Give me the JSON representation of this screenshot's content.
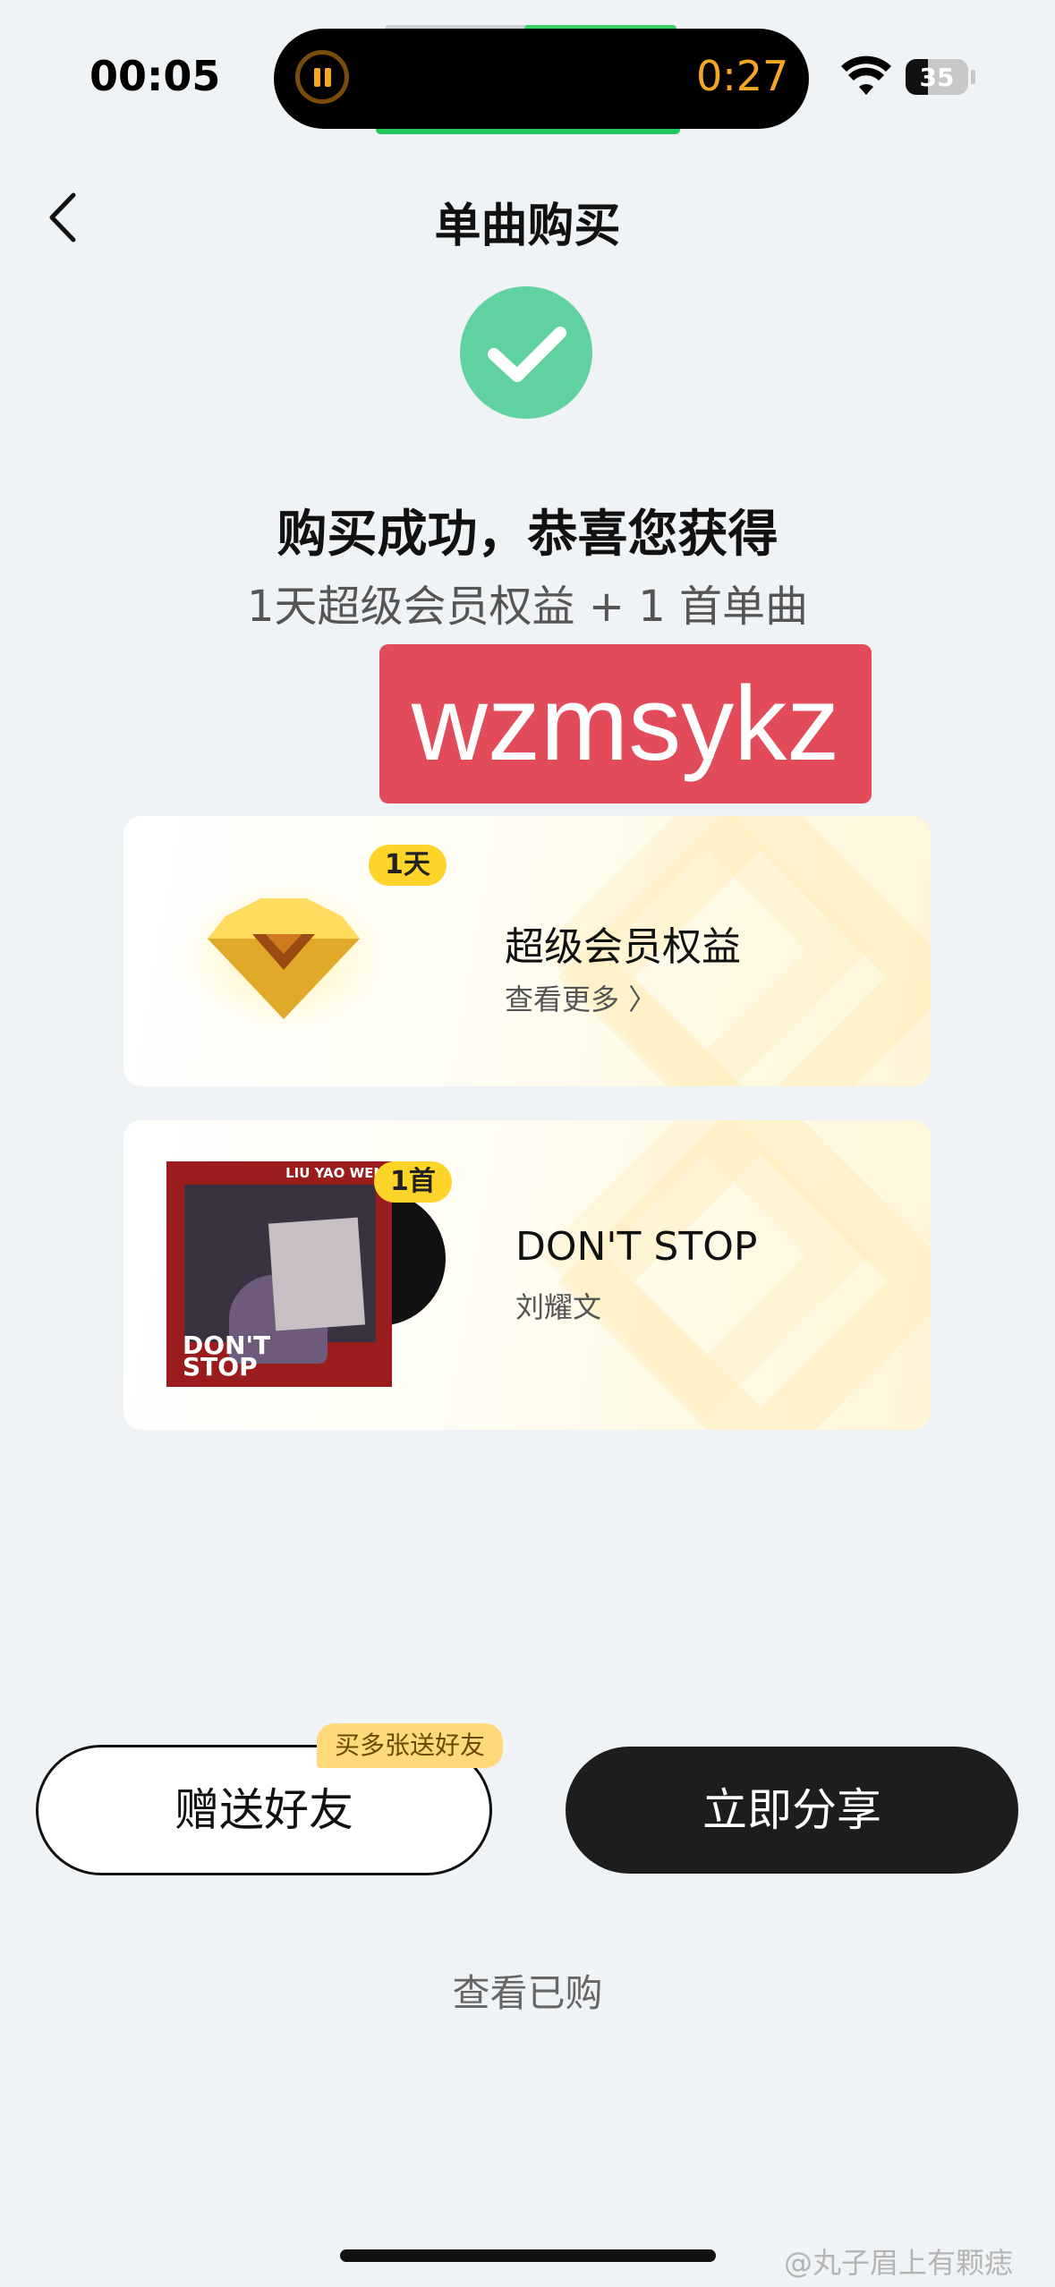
{
  "status": {
    "time": "00:05",
    "timer": "0:27",
    "battery": "35",
    "battery_level": 0.35
  },
  "header": {
    "title": "单曲购买"
  },
  "success": {
    "headline": "购买成功，恭喜您获得",
    "subline": "1天超级会员权益 + 1 首单曲"
  },
  "watermark": "wzmsykz",
  "cards": [
    {
      "badge": "1天",
      "title": "超级会员权益",
      "link": "查看更多 〉",
      "icon": "diamond-icon"
    },
    {
      "badge": "1首",
      "title": "DON'T STOP",
      "artist": "刘耀文",
      "cover_artist": "LIU YAO WEN",
      "cover_title": "DON'T STOP"
    }
  ],
  "actions": {
    "gift": "赠送好友",
    "gift_tag": "买多张送好友",
    "share": "立即分享",
    "purchased": "查看已购"
  },
  "weibo_mark": "@丸子眉上有颗痣",
  "colors": {
    "success": "#5fd29f",
    "badge": "#ffd428",
    "redact": "#e24b5a",
    "dark_button": "#1d1d1d"
  }
}
